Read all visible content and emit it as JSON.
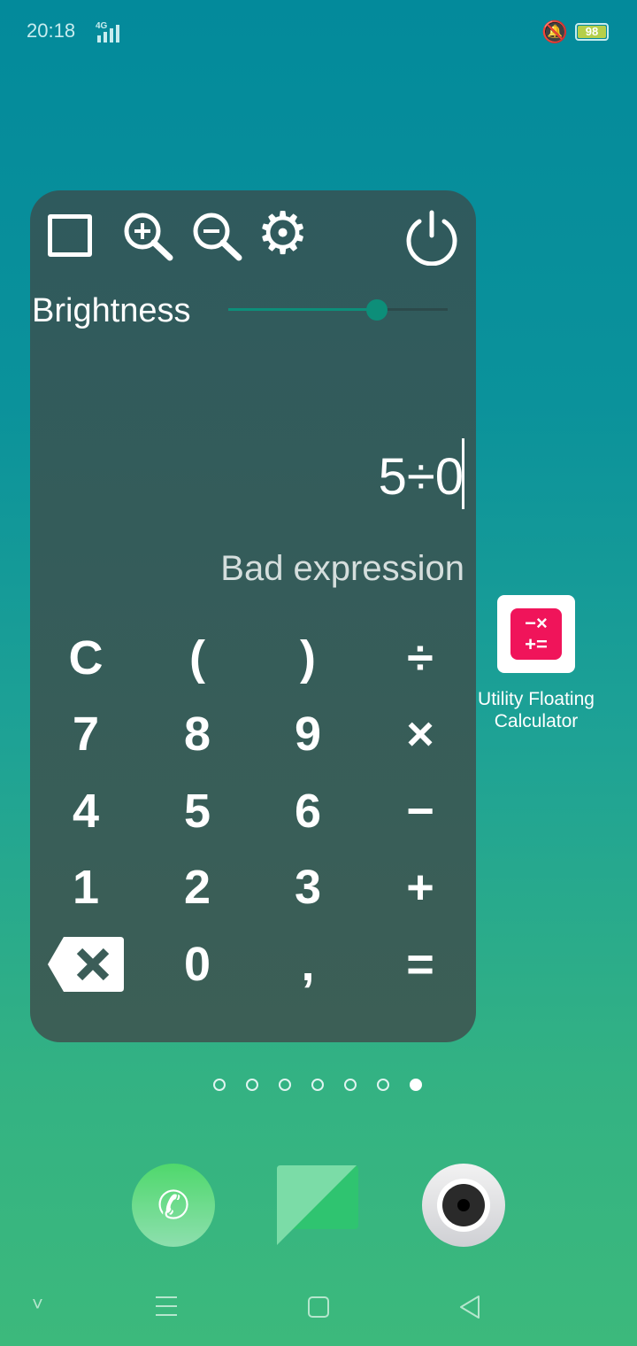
{
  "status_bar": {
    "time": "20:18",
    "network": "4G",
    "battery": "98"
  },
  "calculator": {
    "brightness_label": "Brightness",
    "brightness_value": 0.68,
    "expression": "5÷0",
    "result": "Bad expression",
    "keys": [
      [
        "C",
        "(",
        ")",
        "÷"
      ],
      [
        "7",
        "8",
        "9",
        "×"
      ],
      [
        "4",
        "5",
        "6",
        "−"
      ],
      [
        "1",
        "2",
        "3",
        "+"
      ],
      [
        "backspace",
        "0",
        ",",
        "="
      ]
    ]
  },
  "home": {
    "app_label": "Utility Floating Calculator",
    "page_count": 7,
    "active_page": 7,
    "dock": [
      "phone",
      "files",
      "camera"
    ]
  },
  "colors": {
    "accent": "#0d8e79",
    "app_icon": "#f0145a"
  }
}
